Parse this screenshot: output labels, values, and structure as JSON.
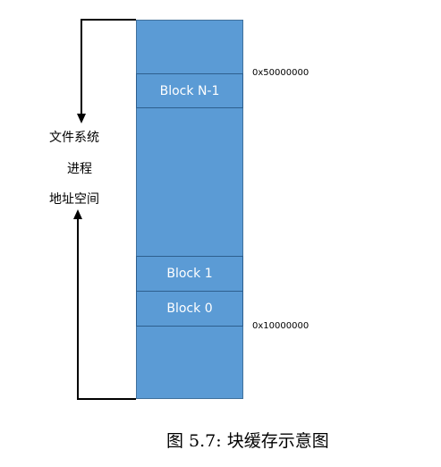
{
  "blocks": [
    {
      "label": "Block N-1"
    },
    {
      "label": "Block 1"
    },
    {
      "label": "Block 0"
    }
  ],
  "addresses": {
    "top": "0x50000000",
    "bottom": "0x10000000"
  },
  "side_labels": [
    "文件系统",
    "进程",
    "地址空间"
  ],
  "caption": "图 5.7: 块缓存示意图",
  "colors": {
    "memory_fill": "#5b9bd5",
    "memory_border": "#41719c",
    "block_text": "#ffffff"
  }
}
